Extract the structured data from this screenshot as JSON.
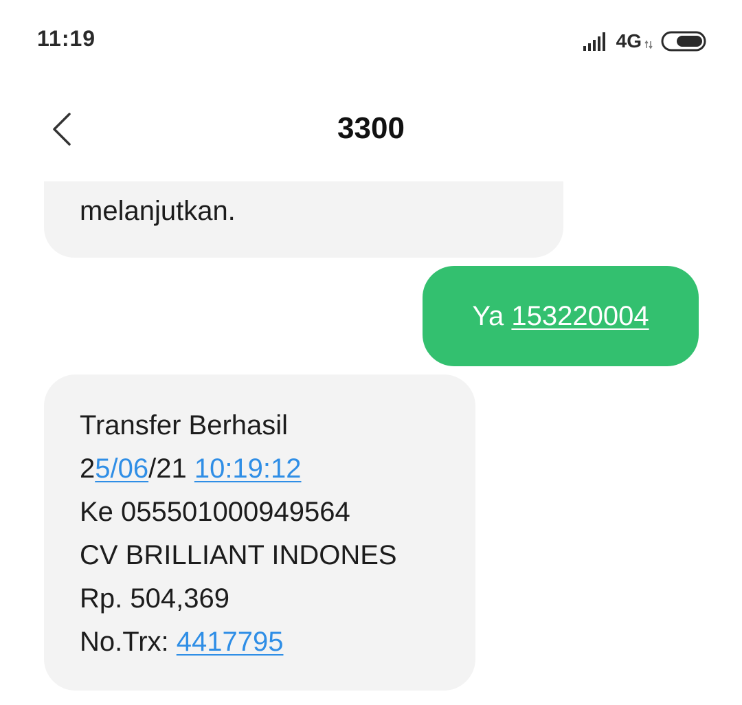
{
  "status_bar": {
    "time": "11:19",
    "network": "4G",
    "signal_icon": "signal-bars-icon",
    "battery_icon": "battery-icon"
  },
  "header": {
    "back_icon": "chevron-left-icon",
    "title": "3300"
  },
  "messages": {
    "partial_incoming": {
      "text": "melanjutkan."
    },
    "outgoing": {
      "prefix": "Ya ",
      "link_number": "153220004",
      "bubble_color": "#33c06f"
    },
    "incoming": {
      "line1": "Transfer Berhasil",
      "date_part1": "2",
      "date_link": "5/06",
      "date_part2": "/21 ",
      "time_link": "10:19:12",
      "line3": "Ke 055501000949564",
      "line4": "CV BRILLIANT INDONES",
      "line5": "Rp. 504,369",
      "trx_label": "No.Trx: ",
      "trx_link": "4417795",
      "bubble_color": "#f3f3f3",
      "link_color": "#2f8ee6"
    }
  }
}
